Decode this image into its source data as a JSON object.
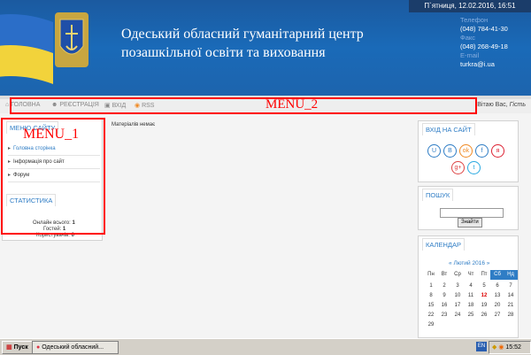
{
  "header": {
    "title_line1": "Одеський обласний гуманітарний центр",
    "title_line2": "позашкільної освіти та виховання",
    "datetime": "П`ятниця, 12.02.2016, 16:51",
    "phone_label": "Телефон",
    "phone1": "(048) 784-41-30",
    "fax_label": "Факс",
    "fax1": "(048) 268-49-18",
    "email_label": "E-mail",
    "email": "turkra@i.ua"
  },
  "nav": {
    "items": [
      "ГОЛОВНА",
      "РЕЄСТРАЦІЯ",
      "ВХІД",
      "RSS"
    ],
    "greeting": "Вітаю Вас,",
    "greeting_name": "Гість"
  },
  "annotations": {
    "menu2": "MENU_2",
    "menu1": "MENU_1"
  },
  "left_menu": {
    "title": "МЕНЮ САЙТУ",
    "items": [
      "Головна сторінка",
      "Інформація про сайт",
      "Форум"
    ]
  },
  "stats": {
    "title": "СТАТИСТИКА",
    "online_label": "Онлайн всього:",
    "online_value": "1",
    "guests_label": "Гостей:",
    "guests_value": "1",
    "users_label": "Користувачів:",
    "users_value": "0"
  },
  "main": {
    "no_materials": "Матеріалів немає"
  },
  "login": {
    "title": "ВХІД НА САЙТ",
    "social": [
      "U",
      "B",
      "ok",
      "f",
      "я",
      "g+",
      "t"
    ]
  },
  "search": {
    "title": "ПОШУК",
    "button": "Знайти"
  },
  "calendar": {
    "title": "КАЛЕНДАР",
    "month": "Лютий 2016",
    "prev": "«",
    "next": "»",
    "weekdays": [
      "Пн",
      "Вт",
      "Ср",
      "Чт",
      "Пт",
      "Сб",
      "Нд"
    ],
    "rows": [
      [
        "1",
        "2",
        "3",
        "4",
        "5",
        "6",
        "7"
      ],
      [
        "8",
        "9",
        "10",
        "11",
        "12",
        "13",
        "14"
      ],
      [
        "15",
        "16",
        "17",
        "18",
        "19",
        "20",
        "21"
      ],
      [
        "22",
        "23",
        "24",
        "25",
        "26",
        "27",
        "28"
      ],
      [
        "29",
        "",
        "",
        "",
        "",
        "",
        ""
      ]
    ],
    "today": "12"
  },
  "taskbar": {
    "start": "Пуск",
    "window": "Одеський обласний...",
    "lang": "EN",
    "time": "15:52"
  },
  "colors": {
    "header_blue": "#1a6ab8",
    "accent_blue": "#2f7dc5",
    "annotation_red": "#ff0000"
  }
}
